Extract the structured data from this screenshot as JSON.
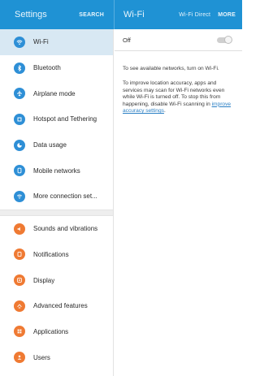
{
  "header": {
    "title": "Settings",
    "search_label": "SEARCH",
    "panel_title": "Wi-Fi",
    "wifi_direct_label": "Wi-Fi Direct",
    "more_label": "MORE"
  },
  "sidebar": {
    "items": [
      {
        "label": "Wi-Fi",
        "icon": "wifi-icon",
        "color": "#2e8fd6"
      },
      {
        "label": "Bluetooth",
        "icon": "bluetooth-icon",
        "color": "#2e8fd6"
      },
      {
        "label": "Airplane mode",
        "icon": "airplane-icon",
        "color": "#2e8fd6"
      },
      {
        "label": "Hotspot and Tethering",
        "icon": "hotspot-icon",
        "color": "#2e8fd6"
      },
      {
        "label": "Data usage",
        "icon": "data-usage-icon",
        "color": "#2e8fd6"
      },
      {
        "label": "Mobile networks",
        "icon": "mobile-networks-icon",
        "color": "#2e8fd6"
      },
      {
        "label": "More connection set...",
        "icon": "more-connections-icon",
        "color": "#2e8fd6"
      },
      {
        "label": "Sounds and vibrations",
        "icon": "sound-icon",
        "color": "#ef7a33"
      },
      {
        "label": "Notifications",
        "icon": "notifications-icon",
        "color": "#ef7a33"
      },
      {
        "label": "Display",
        "icon": "display-icon",
        "color": "#ef7a33"
      },
      {
        "label": "Advanced features",
        "icon": "advanced-features-icon",
        "color": "#ef7a33"
      },
      {
        "label": "Applications",
        "icon": "applications-icon",
        "color": "#ef7a33"
      },
      {
        "label": "Users",
        "icon": "users-icon",
        "color": "#ef7a33"
      }
    ],
    "selected_index": 0
  },
  "detail": {
    "toggle_label": "Off",
    "toggle_on": false,
    "info_text_1": "To see available networks, turn on Wi-Fi.",
    "info_text_2": "To improve location accuracy, apps and services may scan for Wi-Fi networks even while Wi-Fi is turned off. To stop this from happening, disable Wi-Fi scanning in ",
    "info_link": "improve accuracy settings",
    "info_text_2_end": "."
  },
  "colors": {
    "header": "#1f92d4",
    "selected_row": "#d8e8f3",
    "connections_icon": "#2e8fd6",
    "device_icon": "#ef7a33",
    "link": "#2a7fc4"
  }
}
